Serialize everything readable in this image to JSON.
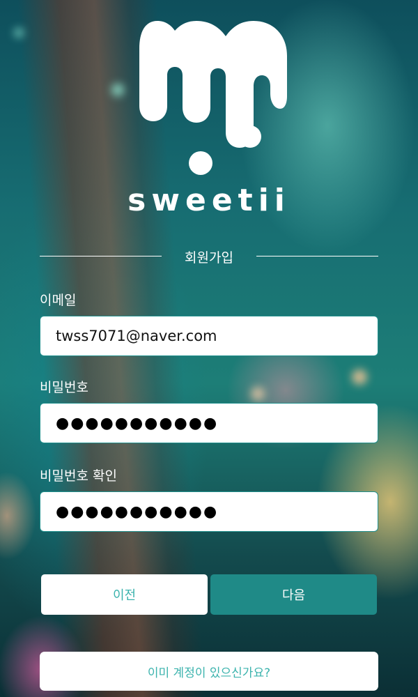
{
  "brand": {
    "logo_icon": "drip-m-logo-icon",
    "name": "sweetii"
  },
  "form": {
    "title": "회원가입",
    "email": {
      "label": "이메일",
      "value": "twss7071@naver.com"
    },
    "password": {
      "label": "비밀번호",
      "masked_value": "●●●●●●●●●●●"
    },
    "password_confirm": {
      "label": "비밀번호 확인",
      "masked_value": "●●●●●●●●●●●"
    }
  },
  "actions": {
    "prev_label": "이전",
    "next_label": "다음",
    "login_link_label": "이미 계정이 있으신가요?"
  },
  "colors": {
    "accent": "#1f8a87",
    "accent_text": "#3bb3ad",
    "input_bg": "#ffffff",
    "text_light": "#ffffff"
  }
}
